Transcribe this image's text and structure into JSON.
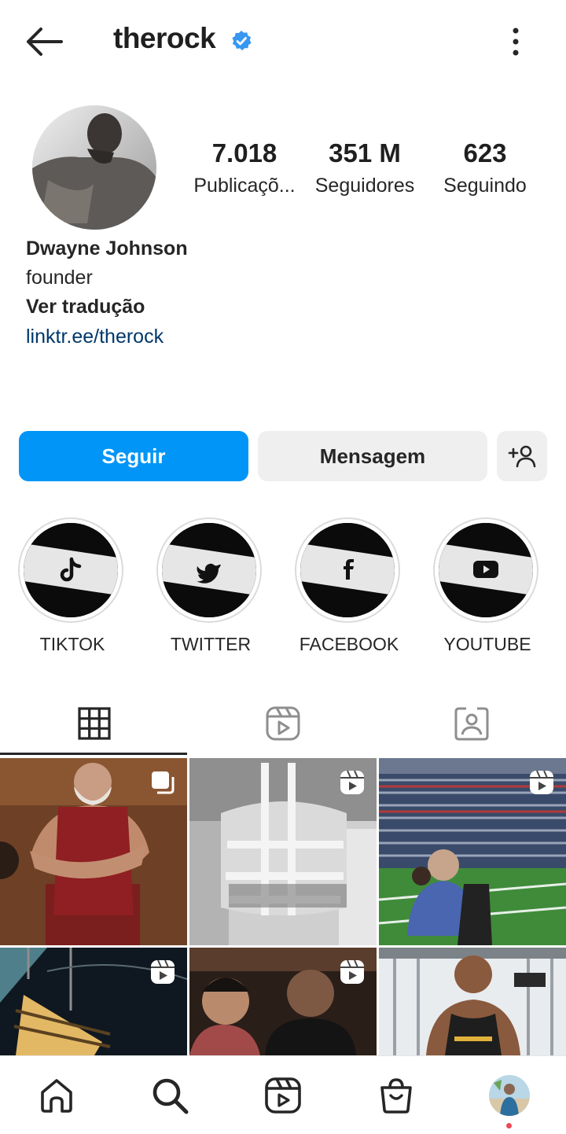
{
  "header": {
    "username": "therock",
    "back_icon": "arrow-left-icon",
    "verified_icon": "verified-badge-icon",
    "more_icon": "more-vertical-icon"
  },
  "profile": {
    "stats": [
      {
        "value": "7.018",
        "label": "Publicaçõ..."
      },
      {
        "value": "351 M",
        "label": "Seguidores"
      },
      {
        "value": "623",
        "label": "Seguindo"
      }
    ],
    "name": "Dwayne Johnson",
    "bio": "founder",
    "translate": "Ver tradução",
    "link": "linktr.ee/therock"
  },
  "actions": {
    "follow": "Seguir",
    "message": "Mensagem",
    "add_icon": "add-user-icon"
  },
  "highlights": [
    {
      "label": "TIKTOK",
      "icon": "tiktok-icon"
    },
    {
      "label": "TWITTER",
      "icon": "twitter-icon"
    },
    {
      "label": "FACEBOOK",
      "icon": "facebook-icon"
    },
    {
      "label": "YOUTUBE",
      "icon": "youtube-icon"
    }
  ],
  "tabs": [
    {
      "name": "grid",
      "icon": "grid-icon",
      "active": true
    },
    {
      "name": "reels",
      "icon": "reels-icon",
      "active": false
    },
    {
      "name": "tagged",
      "icon": "tagged-icon",
      "active": false
    }
  ],
  "posts": [
    {
      "type": "carousel",
      "icon": "carousel-icon"
    },
    {
      "type": "reel",
      "icon": "reel-icon"
    },
    {
      "type": "reel",
      "icon": "reel-icon"
    },
    {
      "type": "reel",
      "icon": "reel-icon"
    },
    {
      "type": "reel",
      "icon": "reel-icon"
    },
    {
      "type": "photo",
      "icon": ""
    }
  ],
  "bottom_nav": [
    {
      "name": "home",
      "icon": "home-icon"
    },
    {
      "name": "search",
      "icon": "search-icon"
    },
    {
      "name": "reels",
      "icon": "reels-icon"
    },
    {
      "name": "shop",
      "icon": "shop-icon"
    },
    {
      "name": "profile",
      "icon": "profile-avatar"
    }
  ],
  "colors": {
    "accent": "#0095f6",
    "verified": "#3897f0",
    "link": "#00376b",
    "notification_dot": "#ed4956"
  }
}
